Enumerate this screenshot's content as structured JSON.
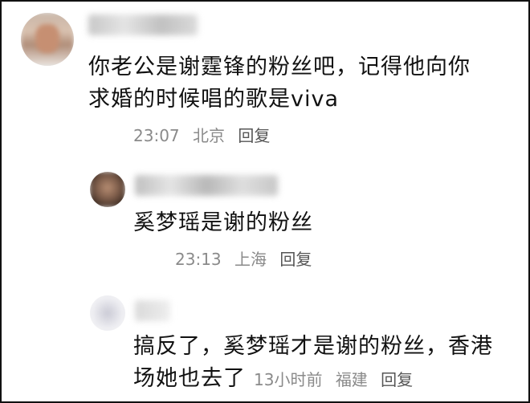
{
  "comments": [
    {
      "text_line1": "你老公是谢霆锋的粉丝吧，记得他向你",
      "text_line2": "求婚的时候唱的歌是viva",
      "time": "23:07",
      "location": "北京",
      "reply_label": "回复"
    },
    {
      "text_line1": "奚梦瑶是谢的粉丝",
      "time": "23:13",
      "location": "上海",
      "reply_label": "回复"
    },
    {
      "text_line1": "搞反了，奚梦瑶才是谢的粉丝，香港",
      "text_line2": "场她也去了",
      "time": "13小时前",
      "location": "福建",
      "reply_label": "回复"
    }
  ]
}
